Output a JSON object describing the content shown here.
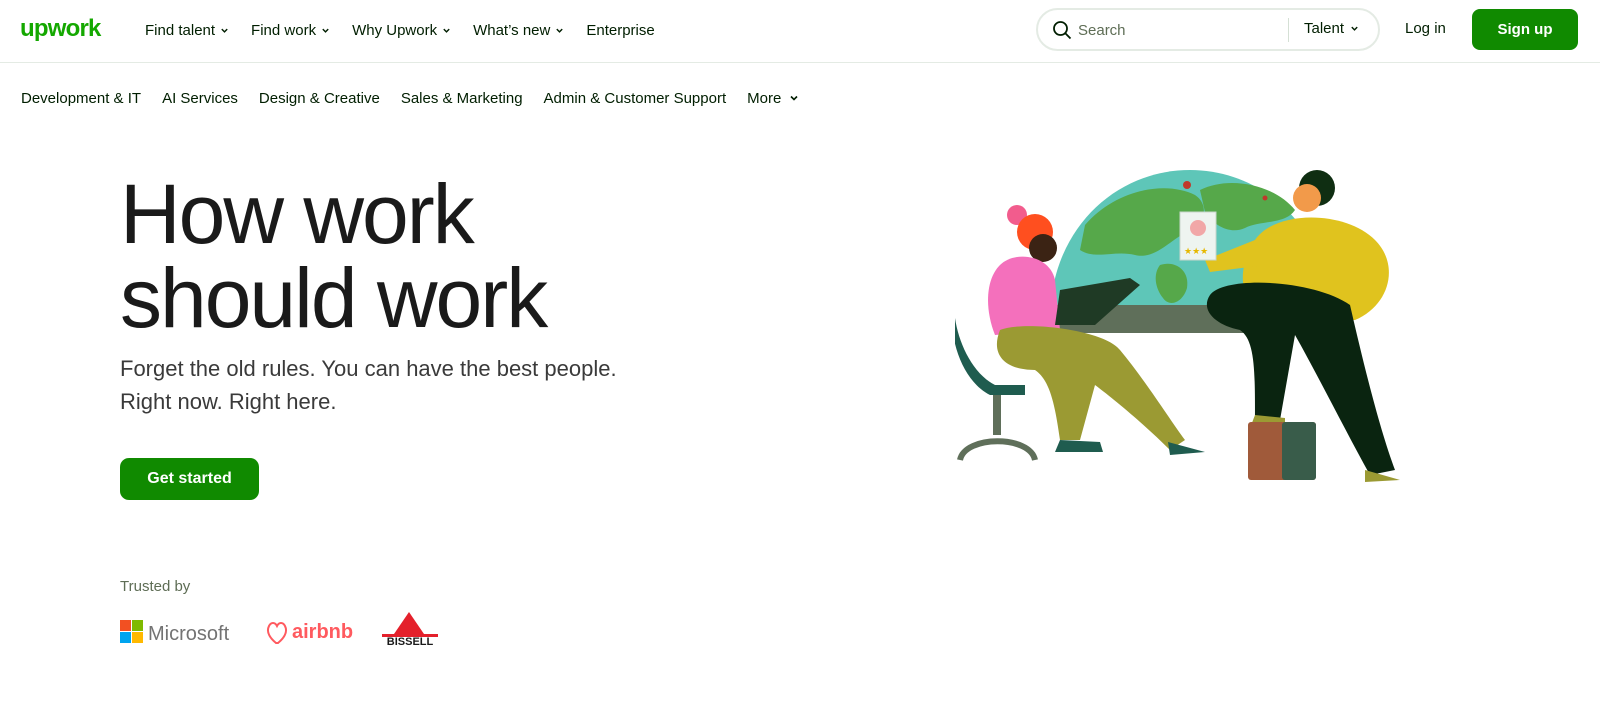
{
  "brand": {
    "logo_text": "upwork",
    "accent_color": "#108a00"
  },
  "topnav": {
    "items": [
      {
        "label": "Find talent",
        "has_dropdown": true
      },
      {
        "label": "Find work",
        "has_dropdown": true
      },
      {
        "label": "Why Upwork",
        "has_dropdown": true
      },
      {
        "label": "What’s new",
        "has_dropdown": true
      },
      {
        "label": "Enterprise",
        "has_dropdown": false
      }
    ],
    "search": {
      "placeholder": "Search",
      "scope_label": "Talent",
      "icon": "search-icon"
    },
    "login_label": "Log in",
    "signup_label": "Sign up"
  },
  "categories": {
    "items": [
      {
        "label": "Development & IT"
      },
      {
        "label": "AI Services"
      },
      {
        "label": "Design & Creative"
      },
      {
        "label": "Sales & Marketing"
      },
      {
        "label": "Admin & Customer Support"
      },
      {
        "label": "More",
        "has_dropdown": true
      }
    ]
  },
  "hero": {
    "title_line1": "How work",
    "title_line2": "should work",
    "subtitle_line1": "Forget the old rules. You can have the best people.",
    "subtitle_line2": "Right now. Right here.",
    "cta_label": "Get started"
  },
  "trusted": {
    "label": "Trusted by",
    "logos": [
      {
        "name": "Microsoft"
      },
      {
        "name": "airbnb"
      },
      {
        "name": "BISSELL"
      }
    ]
  }
}
